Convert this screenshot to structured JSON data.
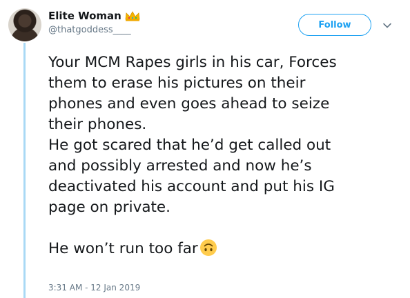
{
  "user": {
    "display_name": "Elite Woman",
    "handle": "@thatgoddess____",
    "badge_icon": "crown-emoji"
  },
  "actions": {
    "follow_label": "Follow",
    "menu_icon": "chevron-down-icon"
  },
  "tweet": {
    "text": "Your MCM Rapes girls in his car, Forces\nthem to erase his pictures on their\nphones and even goes ahead to seize\ntheir phones.\nHe got scared that he’d get called out\nand possibly arrested and now he’s\ndeactivated his account and put his IG\npage on private.\n\nHe won’t run too far",
    "trailing_emoji": "upside-down-face-emoji",
    "timestamp": "3:31 AM - 12 Jan 2019"
  },
  "colors": {
    "accent": "#1da1f2",
    "thread_line": "#a9d9f5",
    "secondary_text": "#657786"
  }
}
